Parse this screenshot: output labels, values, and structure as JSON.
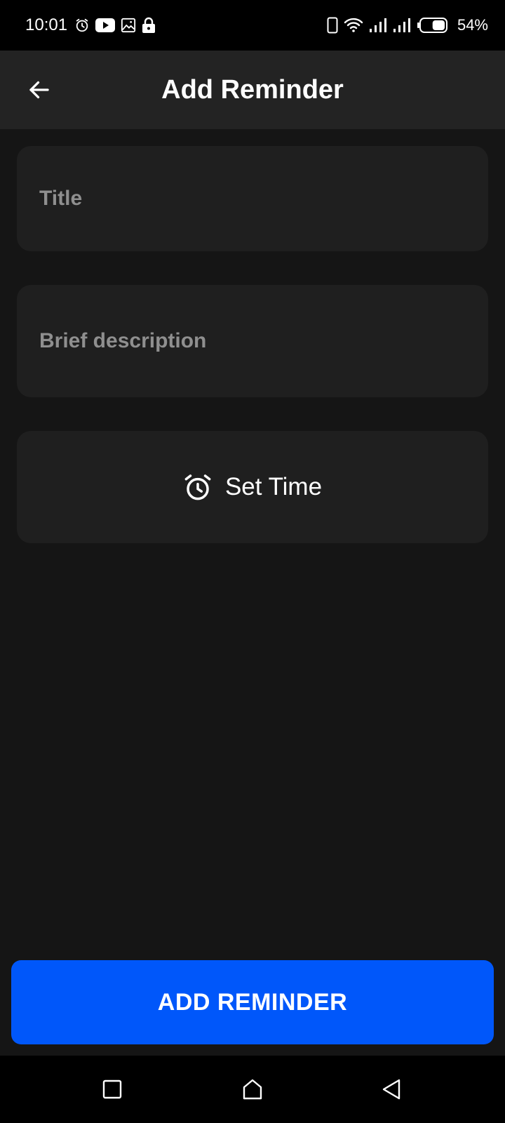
{
  "status_bar": {
    "time": "10:01",
    "battery_percent": "54%",
    "left_icons": [
      "alarm-icon",
      "youtube-icon",
      "gallery-icon",
      "lock-icon"
    ],
    "right_icons": [
      "phone-icon",
      "wifi-icon",
      "signal-1-icon",
      "signal-2-icon",
      "battery-icon"
    ],
    "battery_level": 0.54
  },
  "app_bar": {
    "title": "Add Reminder",
    "back_icon": "arrow-left-icon"
  },
  "form": {
    "title": {
      "placeholder": "Title",
      "value": ""
    },
    "description": {
      "placeholder": "Brief description",
      "value": ""
    },
    "set_time": {
      "label": "Set Time",
      "icon": "alarm-clock-icon"
    }
  },
  "primary_action": {
    "label": "ADD REMINDER"
  },
  "nav_bar": {
    "items": [
      "recents-square-icon",
      "home-icon",
      "back-triangle-icon"
    ]
  },
  "colors": {
    "background": "#151515",
    "app_bar": "#232323",
    "card": "#1f1f1f",
    "placeholder": "#8f8f8f",
    "accent": "#0057fa",
    "status_bar": "#000000"
  }
}
